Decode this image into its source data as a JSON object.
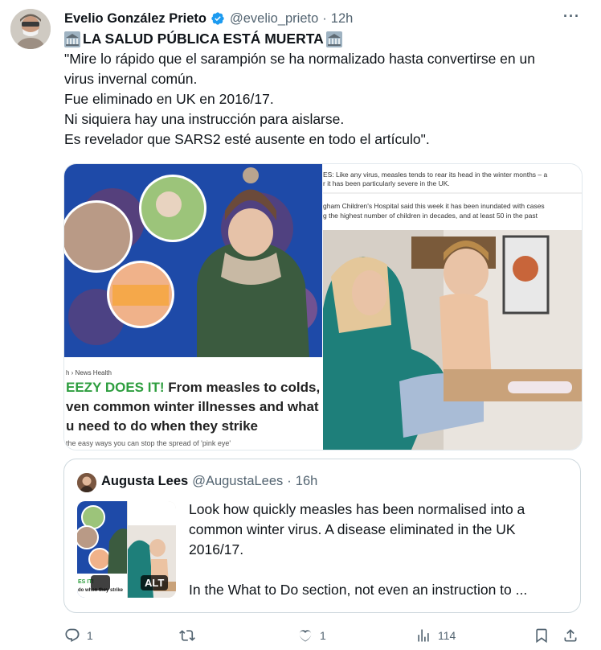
{
  "author": {
    "name": "Evelio González Prieto",
    "handle": "@evelio_prieto",
    "time": "12h",
    "more": "···"
  },
  "tweet": {
    "headline": "LA SALUD PÚBLICA ESTÁ MUERTA",
    "lines": [
      "\"Mire lo rápido que el sarampión se ha normalizado hasta convertirse en un",
      "virus invernal común.",
      "Fue eliminado en UK en 2016/17.",
      "Ni siquiera hay una instrucción para aislarse.",
      "Es revelador que SARS2 esté ausente en todo el artículo\"."
    ]
  },
  "media": {
    "left": {
      "breadcrumb": "h › News Health",
      "headline_1": "EEZY DOES IT!",
      "headline_1_rest": " From measles to colds,",
      "headline_2": "ven common winter illnesses and what",
      "headline_3": "u need to do when they strike",
      "subline": "the easy ways you can stop the spread of 'pink eye'"
    },
    "right": {
      "text_1": "ES: Like any virus, measles tends to rear its head in the winter months – a",
      "text_2": "r it has been particularly severe in the UK.",
      "text_3": "gham Children's Hospital said this week it has been inundated with cases",
      "text_4": "g the highest number of children in decades, and at least 50 in the past"
    }
  },
  "quote": {
    "name": "Augusta Lees",
    "handle": "@AugustaLees",
    "time": "16h",
    "alt_label": "ALT",
    "text_lines": [
      "Look how quickly measles has been normalised into a",
      "common winter virus. A disease eliminated in the UK",
      "2016/17.",
      "",
      "In the What to Do section, not even an instruction to ..."
    ]
  },
  "actions": {
    "reply_count": "1",
    "retweet_count": "",
    "like_count": "1",
    "views_count": "114"
  },
  "colors": {
    "text": "#0f1419",
    "secondary": "#536471",
    "verified": "#1d9bf0",
    "border": "#cfd9de"
  }
}
